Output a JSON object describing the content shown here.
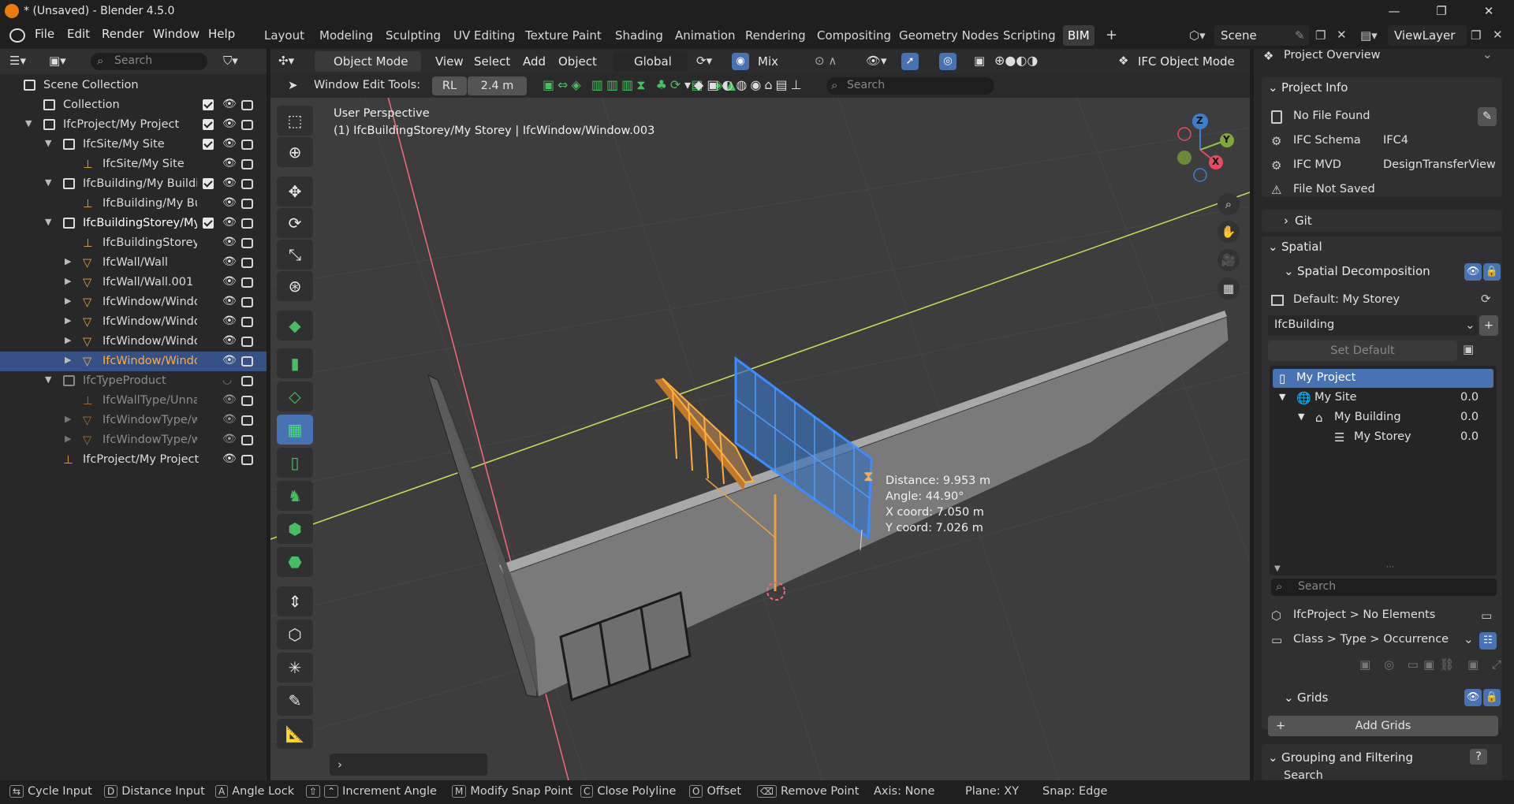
{
  "titlebar": {
    "title": "* (Unsaved) - Blender 4.5.0"
  },
  "menu": {
    "file": "File",
    "edit": "Edit",
    "render": "Render",
    "window": "Window",
    "help": "Help"
  },
  "workspaces": [
    "Layout",
    "Modeling",
    "Sculpting",
    "UV Editing",
    "Texture Paint",
    "Shading",
    "Animation",
    "Rendering",
    "Compositing",
    "Geometry Nodes",
    "Scripting",
    "BIM"
  ],
  "scene": {
    "name": "Scene",
    "view_layer": "ViewLayer"
  },
  "outliner": {
    "search_placeholder": "Search",
    "rows": [
      {
        "label": "Scene Collection"
      },
      {
        "label": "Collection"
      },
      {
        "label": "IfcProject/My Project"
      },
      {
        "label": "IfcSite/My Site"
      },
      {
        "label": "IfcSite/My Site"
      },
      {
        "label": "IfcBuilding/My Building"
      },
      {
        "label": "IfcBuilding/My Bui"
      },
      {
        "label": "IfcBuildingStorey/My S"
      },
      {
        "label": "IfcBuildingStorey/I"
      },
      {
        "label": "IfcWall/Wall"
      },
      {
        "label": "IfcWall/Wall.001"
      },
      {
        "label": "IfcWindow/Window"
      },
      {
        "label": "IfcWindow/Window"
      },
      {
        "label": "IfcWindow/Window"
      },
      {
        "label": "IfcWindow/Window"
      },
      {
        "label": "IfcTypeProduct"
      },
      {
        "label": "IfcWallType/Unna"
      },
      {
        "label": "IfcWindowType/w"
      },
      {
        "label": "IfcWindowType/w"
      },
      {
        "label": "IfcProject/My Project"
      }
    ]
  },
  "viewport_header": {
    "mode": "Object Mode",
    "view": "View",
    "select": "Select",
    "add": "Add",
    "object": "Object",
    "orientation": "Global",
    "mix": "Mix",
    "ifc_mode": "IFC Object Mode"
  },
  "viewport_tools": {
    "label": "Window Edit Tools:",
    "rl": "RL",
    "height": "2.4 m",
    "search_placeholder": "Search"
  },
  "viewport": {
    "perspective": "User Perspective",
    "context": "(1) IfcBuildingStorey/My Storey | IfcWindow/Window.003",
    "distance": "Distance: 9.953 m",
    "angle": "Angle: 44.90°",
    "xcoord": "X coord: 7.050 m",
    "ycoord": "Y coord: 7.026 m",
    "gizmo": {
      "z": "Z",
      "y": "Y",
      "x": "X"
    }
  },
  "properties": {
    "overview": "Project Overview",
    "project_info": "Project Info",
    "no_file": "No File Found",
    "schema_label": "IFC Schema",
    "schema_value": "IFC4",
    "mvd_label": "IFC MVD",
    "mvd_value": "DesignTransferView",
    "not_saved": "File Not Saved",
    "git": "Git",
    "spatial": "Spatial",
    "spatial_decomp": "Spatial Decomposition",
    "default_storey": "Default: My Storey",
    "building_select": "IfcBuilding",
    "set_default": "Set Default",
    "tree": [
      {
        "name": "My Project",
        "value": ""
      },
      {
        "name": "My Site",
        "value": "0.0"
      },
      {
        "name": "My Building",
        "value": "0.0"
      },
      {
        "name": "My Storey",
        "value": "0.0"
      }
    ],
    "search_placeholder": "Search",
    "elements": "IfcProject > No Elements",
    "class_select": "Class > Type > Occurrence",
    "grids": "Grids",
    "add_grids": "Add Grids",
    "grouping": "Grouping and Filtering",
    "search_sub": "Search"
  },
  "statusbar": {
    "cycle": "Cycle Input",
    "distance": "Distance Input",
    "angle": "Angle Lock",
    "increment": "Increment Angle",
    "snap": "Modify Snap Point",
    "close": "Close Polyline",
    "offset": "Offset",
    "remove": "Remove Point",
    "axis": "Axis: None",
    "plane": "Plane: XY",
    "snapmode": "Snap: Edge",
    "keys": {
      "d": "D",
      "a": "A",
      "m": "M",
      "c": "C",
      "o": "O"
    }
  },
  "colors": {
    "accent": "#4772b3",
    "selected_orange": "#ffae3a",
    "window_blue": "#3b8cff"
  }
}
